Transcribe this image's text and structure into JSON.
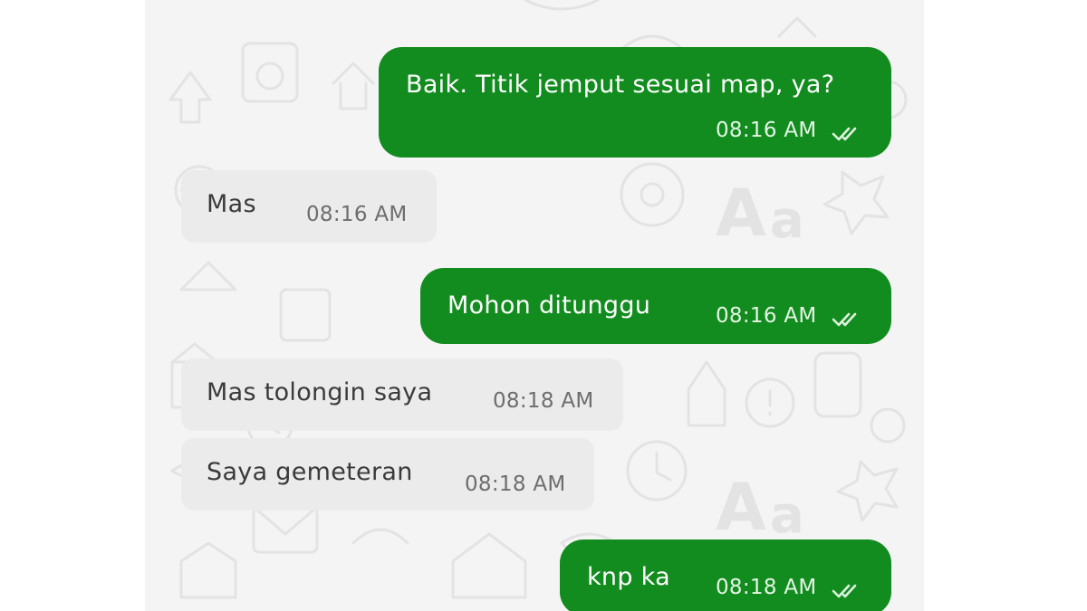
{
  "colors": {
    "outgoing_bubble": "#128c1e",
    "incoming_bubble": "#ebebeb",
    "chat_background": "#f4f4f4"
  },
  "icons": {
    "read_receipt": "double-check-icon"
  },
  "messages": [
    {
      "direction": "outgoing",
      "text": "Baik. Titik jemput sesuai map, ya?",
      "time": "08:16 AM",
      "status": "read"
    },
    {
      "direction": "incoming",
      "text": "Mas",
      "time": "08:16 AM"
    },
    {
      "direction": "outgoing",
      "text": "Mohon ditunggu",
      "time": "08:16 AM",
      "status": "read"
    },
    {
      "direction": "incoming",
      "text": "Mas tolongin saya",
      "time": "08:18 AM"
    },
    {
      "direction": "incoming",
      "text": "Saya gemeteran",
      "time": "08:18 AM"
    },
    {
      "direction": "outgoing",
      "text": "knp ka",
      "time": "08:18 AM",
      "status": "read"
    }
  ]
}
